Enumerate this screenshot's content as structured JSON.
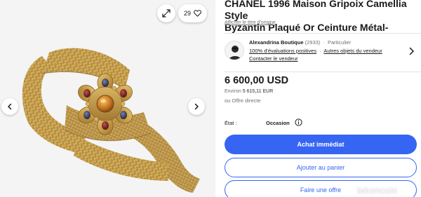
{
  "gallery": {
    "watch_count": "29",
    "expand_icon": "expand-icon",
    "heart_icon": "heart-icon",
    "prev_icon": "chevron-left-icon",
    "next_icon": "chevron-right-icon"
  },
  "listing": {
    "title_line1": "CHANEL 1996 Maison Gripoix Camellia Style",
    "title_line2": "Byzantin Plaqué Or Ceinture Métal-",
    "original_title_link": "Afficher le titre d'origine"
  },
  "seller": {
    "name": "Alexandrina Boutique",
    "feedback_count": "(2933)",
    "type": "Particulier",
    "positive_feedback": "100% d'évaluations positives",
    "other_items_link": "Autres objets du vendeur",
    "contact_link": "Contacter le vendeur"
  },
  "pricing": {
    "price": "6 600,00 USD",
    "approx_prefix": "Environ",
    "approx_value": "5 615,11 EUR",
    "offer_text": "ou Offre directe"
  },
  "condition": {
    "label": "État :",
    "value": "Occasion"
  },
  "actions": {
    "buy_now": "Achat immédiat",
    "add_to_cart": "Ajouter au panier",
    "make_offer": "Faire une offre"
  },
  "watermark": "leboncoin",
  "colors": {
    "primary": "#3665f3",
    "text": "#191919",
    "muted": "#707070",
    "gold": "#c9a24a"
  }
}
